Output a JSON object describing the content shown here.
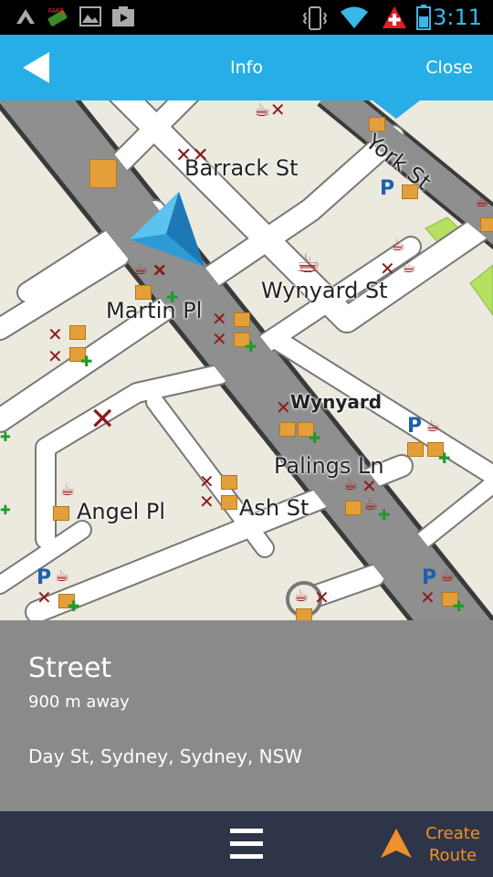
{
  "status_bar": {
    "time": "3:11",
    "left_icons": [
      "android-debug-icon",
      "fake-gps-icon",
      "gallery-icon",
      "media-icon"
    ],
    "right_icons": [
      "vibrate-icon",
      "wifi-icon",
      "medical-alert-icon",
      "battery-icon"
    ]
  },
  "header": {
    "back_icon": "back-arrow-icon",
    "title": "Info",
    "close_label": "Close",
    "color": "#27aee6"
  },
  "map": {
    "street_labels": {
      "barrack": "Barrack St",
      "york": "York St",
      "wynyard_st": "Wynyard St",
      "martin": "Martin Pl",
      "wynyard": "Wynyard",
      "palings": "Palings Ln",
      "angel": "Angel Pl",
      "ash": "Ash St"
    },
    "poi_icons": [
      "restaurant-icon",
      "cafe-icon",
      "shop-icon",
      "parking-icon",
      "pharmacy-icon"
    ],
    "position_marker": "navigation-arrow-icon"
  },
  "info": {
    "type": "Street",
    "distance": "900 m away",
    "address": "Day St, Sydney, Sydney, NSW"
  },
  "bottom_bar": {
    "menu_icon": "hamburger-menu-icon",
    "route_icon": "route-arrow-icon",
    "route_label_line1": "Create",
    "route_label_line2": "Route",
    "accent": "#f0902a"
  }
}
